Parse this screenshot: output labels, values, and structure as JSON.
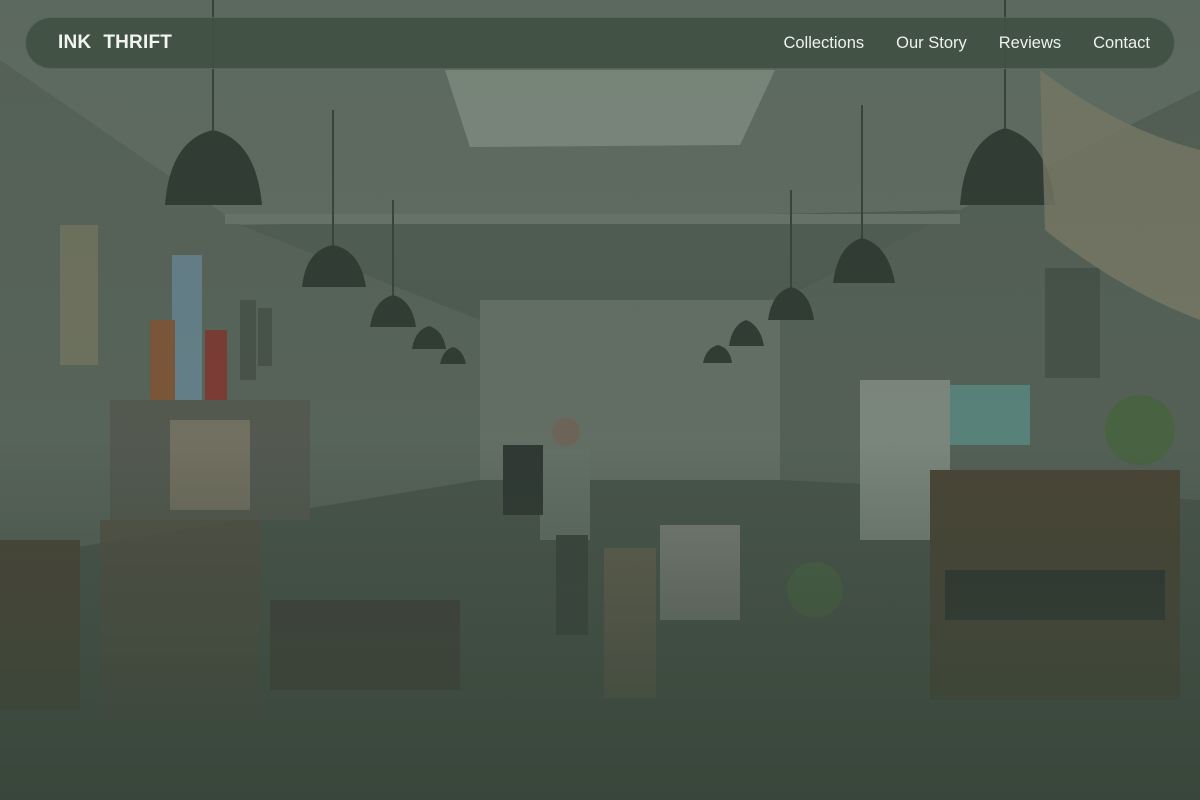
{
  "brand": {
    "word1": "INK",
    "word2": "THRIFT"
  },
  "nav": {
    "links": [
      "Collections",
      "Our Story",
      "Reviews",
      "Contact"
    ]
  },
  "colors": {
    "nav_background": "#405042",
    "overlay_tint": "#384638",
    "nav_text": "#eef1ec"
  },
  "hero": {
    "image": "thrift-store-interior-photo"
  }
}
